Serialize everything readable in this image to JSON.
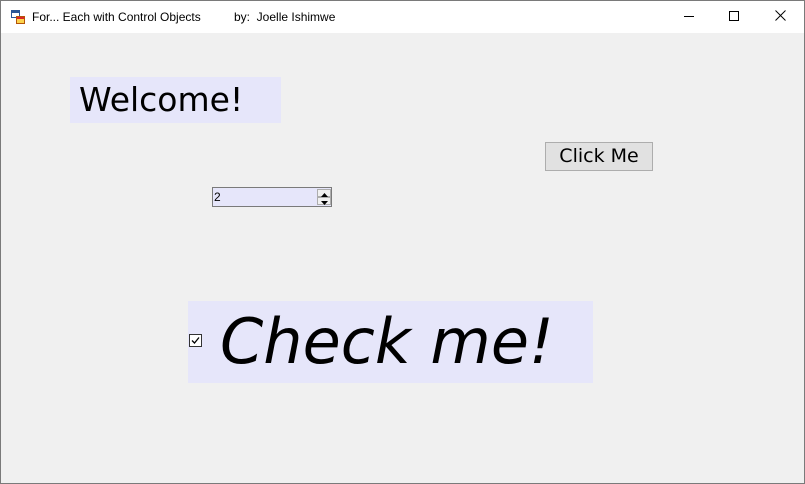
{
  "window": {
    "title": "For... Each with Control Objects",
    "byline": "by:  Joelle Ishimwe",
    "caption_buttons": {
      "minimize_icon": "minimize-icon",
      "maximize_icon": "maximize-icon",
      "close_icon": "close-icon"
    },
    "app_icon": "form-app-icon"
  },
  "form": {
    "welcome_label": "Welcome!",
    "click_button_label": "Click Me",
    "numeric_value": "2",
    "checkbox_checked": true,
    "checkbox_label": "Check me!",
    "label_background": "#e6e6fa",
    "form_background": "#f0f0f0"
  }
}
